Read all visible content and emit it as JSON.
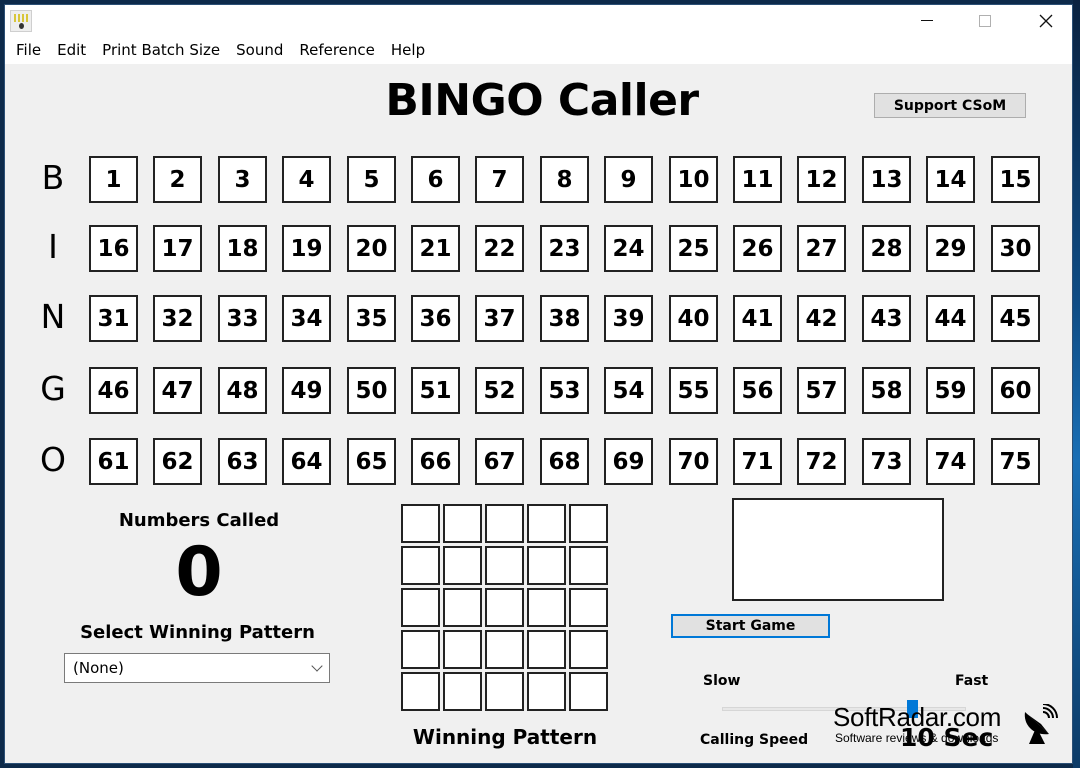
{
  "window": {
    "controls": {
      "minimize": "minimize",
      "maximize": "maximize",
      "close": "close"
    }
  },
  "menu": [
    {
      "label": "File"
    },
    {
      "label": "Edit"
    },
    {
      "label": "Print Batch Size"
    },
    {
      "label": "Sound"
    },
    {
      "label": "Reference"
    },
    {
      "label": "Help"
    }
  ],
  "header": {
    "title": "BINGO Caller",
    "support_button": "Support CSoM"
  },
  "board": {
    "rows": [
      {
        "letter": "B",
        "numbers": [
          "1",
          "2",
          "3",
          "4",
          "5",
          "6",
          "7",
          "8",
          "9",
          "10",
          "11",
          "12",
          "13",
          "14",
          "15"
        ]
      },
      {
        "letter": "I",
        "numbers": [
          "16",
          "17",
          "18",
          "19",
          "20",
          "21",
          "22",
          "23",
          "24",
          "25",
          "26",
          "27",
          "28",
          "29",
          "30"
        ]
      },
      {
        "letter": "N",
        "numbers": [
          "31",
          "32",
          "33",
          "34",
          "35",
          "36",
          "37",
          "38",
          "39",
          "40",
          "41",
          "42",
          "43",
          "44",
          "45"
        ]
      },
      {
        "letter": "G",
        "numbers": [
          "46",
          "47",
          "48",
          "49",
          "50",
          "51",
          "52",
          "53",
          "54",
          "55",
          "56",
          "57",
          "58",
          "59",
          "60"
        ]
      },
      {
        "letter": "O",
        "numbers": [
          "61",
          "62",
          "63",
          "64",
          "65",
          "66",
          "67",
          "68",
          "69",
          "70",
          "71",
          "72",
          "73",
          "74",
          "75"
        ]
      }
    ]
  },
  "numbers_called": {
    "label": "Numbers Called",
    "count": "0"
  },
  "pattern": {
    "select_label": "Select Winning Pattern",
    "selected": "(None)",
    "grid_label": "Winning Pattern",
    "grid_size": 5
  },
  "controls": {
    "start_button": "Start Game",
    "slow_label": "Slow",
    "fast_label": "Fast",
    "speed_label": "Calling Speed",
    "speed_value": "10 Sec",
    "speed_slider_fraction": 0.78,
    "accent_color": "#0078d7"
  },
  "watermark": {
    "main": "SoftRadar.com",
    "sub": "Software reviews & downloads",
    "icon": "satellite-dish-icon"
  }
}
